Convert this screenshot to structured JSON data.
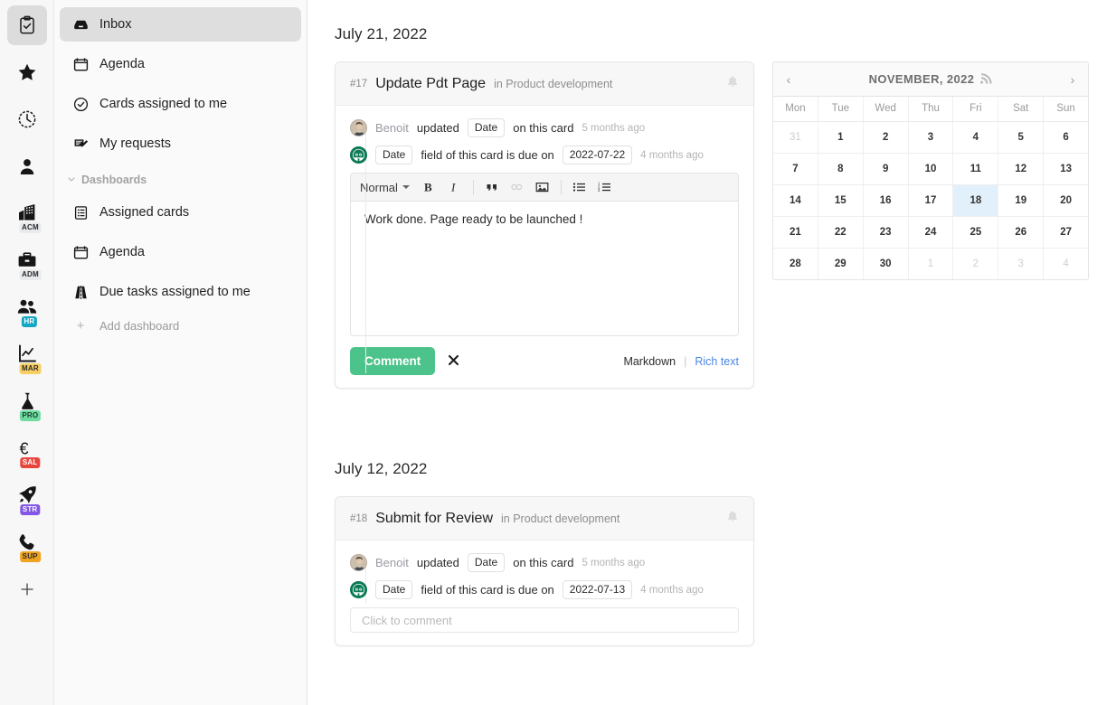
{
  "rail": {
    "items": [
      {
        "name": "clipboard-check",
        "badge": null,
        "active": true
      },
      {
        "name": "star",
        "badge": null,
        "active": false
      },
      {
        "name": "clock",
        "badge": null,
        "active": false
      },
      {
        "name": "person",
        "badge": null,
        "active": false
      },
      {
        "name": "building",
        "badge": "ACM",
        "badge_bg": "#e9eaee",
        "badge_fg": "#2b2b2b",
        "active": false
      },
      {
        "name": "briefcase",
        "badge": "ADM",
        "badge_bg": "#e9eaee",
        "badge_fg": "#2b2b2b",
        "active": false
      },
      {
        "name": "people",
        "badge": "HR",
        "badge_bg": "#14a7c4",
        "badge_fg": "#ffffff",
        "active": false
      },
      {
        "name": "chart",
        "badge": "MAR",
        "badge_bg": "#f7cf64",
        "badge_fg": "#2b2b2b",
        "active": false
      },
      {
        "name": "flask",
        "badge": "PRO",
        "badge_bg": "#6fdba0",
        "badge_fg": "#173d2b",
        "active": false
      },
      {
        "name": "euro",
        "badge": "SAL",
        "badge_bg": "#e8453c",
        "badge_fg": "#ffffff",
        "active": false
      },
      {
        "name": "rocket",
        "badge": "STR",
        "badge_bg": "#8257e5",
        "badge_fg": "#ffffff",
        "active": false
      },
      {
        "name": "phone",
        "badge": "SUP",
        "badge_bg": "#f0a31e",
        "badge_fg": "#2b2b2b",
        "active": false
      }
    ],
    "add_label": "+"
  },
  "sidebar": {
    "items": [
      {
        "label": "Inbox",
        "icon": "inbox-icon",
        "active": true
      },
      {
        "label": "Agenda",
        "icon": "calendar-icon",
        "active": false
      },
      {
        "label": "Cards assigned to me",
        "icon": "check-circle-icon",
        "active": false
      },
      {
        "label": "My requests",
        "icon": "request-icon",
        "active": false
      }
    ],
    "section": {
      "label": "Dashboards",
      "expanded": true
    },
    "dashboards": [
      {
        "label": "Assigned cards",
        "icon": "list-card-icon"
      },
      {
        "label": "Agenda",
        "icon": "calendar-icon"
      },
      {
        "label": "Due tasks assigned to me",
        "icon": "road-icon"
      }
    ],
    "add_dashboard": "Add dashboard"
  },
  "feed": {
    "groups": [
      {
        "date_heading": "July 21, 2022",
        "card": {
          "number": "#17",
          "title": "Update Pdt Page",
          "in_label": "in Product development",
          "events": [
            {
              "avatar": "photo",
              "user": "Benoit",
              "verb": "updated",
              "chip": "Date",
              "tail": "on this card",
              "ago": "5 months ago"
            },
            {
              "avatar": "logo",
              "chip": "Date",
              "text": "field of this card is due on",
              "chip2": "2022-07-22",
              "ago": "4 months ago"
            }
          ],
          "editor": {
            "format_label": "Normal",
            "tools": [
              "bold",
              "italic",
              "blockquote",
              "link",
              "image",
              "bullet-list",
              "ordered-list"
            ],
            "content": "Work done. Page ready to be launched !",
            "comment_button": "Comment",
            "cancel_icon": "✖",
            "markdown_label": "Markdown",
            "separator": "|",
            "richtext_label": "Rich text"
          }
        }
      },
      {
        "date_heading": "July 12, 2022",
        "card": {
          "number": "#18",
          "title": "Submit for Review",
          "in_label": "in Product development",
          "events": [
            {
              "avatar": "photo",
              "user": "Benoit",
              "verb": "updated",
              "chip": "Date",
              "tail": "on this card",
              "ago": "5 months ago"
            },
            {
              "avatar": "logo",
              "chip": "Date",
              "text": "field of this card is due on",
              "chip2": "2022-07-13",
              "ago": "4 months ago"
            }
          ],
          "comment_placeholder": "Click to comment"
        }
      }
    ]
  },
  "calendar": {
    "title": "NOVEMBER, 2022",
    "prev": "‹",
    "next": "›",
    "rss_icon": "rss-icon",
    "dows": [
      "Mon",
      "Tue",
      "Wed",
      "Thu",
      "Fri",
      "Sat",
      "Sun"
    ],
    "today_highlight": "#e2f0fb",
    "weeks": [
      [
        {
          "d": "31",
          "muted": true
        },
        {
          "d": "1"
        },
        {
          "d": "2"
        },
        {
          "d": "3"
        },
        {
          "d": "4"
        },
        {
          "d": "5"
        },
        {
          "d": "6"
        }
      ],
      [
        {
          "d": "7"
        },
        {
          "d": "8"
        },
        {
          "d": "9"
        },
        {
          "d": "10"
        },
        {
          "d": "11"
        },
        {
          "d": "12"
        },
        {
          "d": "13"
        }
      ],
      [
        {
          "d": "14"
        },
        {
          "d": "15"
        },
        {
          "d": "16"
        },
        {
          "d": "17"
        },
        {
          "d": "18",
          "today": true
        },
        {
          "d": "19"
        },
        {
          "d": "20"
        }
      ],
      [
        {
          "d": "21"
        },
        {
          "d": "22"
        },
        {
          "d": "23"
        },
        {
          "d": "24"
        },
        {
          "d": "25"
        },
        {
          "d": "26"
        },
        {
          "d": "27"
        }
      ],
      [
        {
          "d": "28"
        },
        {
          "d": "29"
        },
        {
          "d": "30"
        },
        {
          "d": "1",
          "muted": true
        },
        {
          "d": "2",
          "muted": true
        },
        {
          "d": "3",
          "muted": true
        },
        {
          "d": "4",
          "muted": true
        }
      ]
    ]
  },
  "colors": {
    "accent_green": "#4cc38a",
    "link_blue": "#4a86e8",
    "active_nav": "#dedede",
    "card_header": "#f7f7f7"
  }
}
